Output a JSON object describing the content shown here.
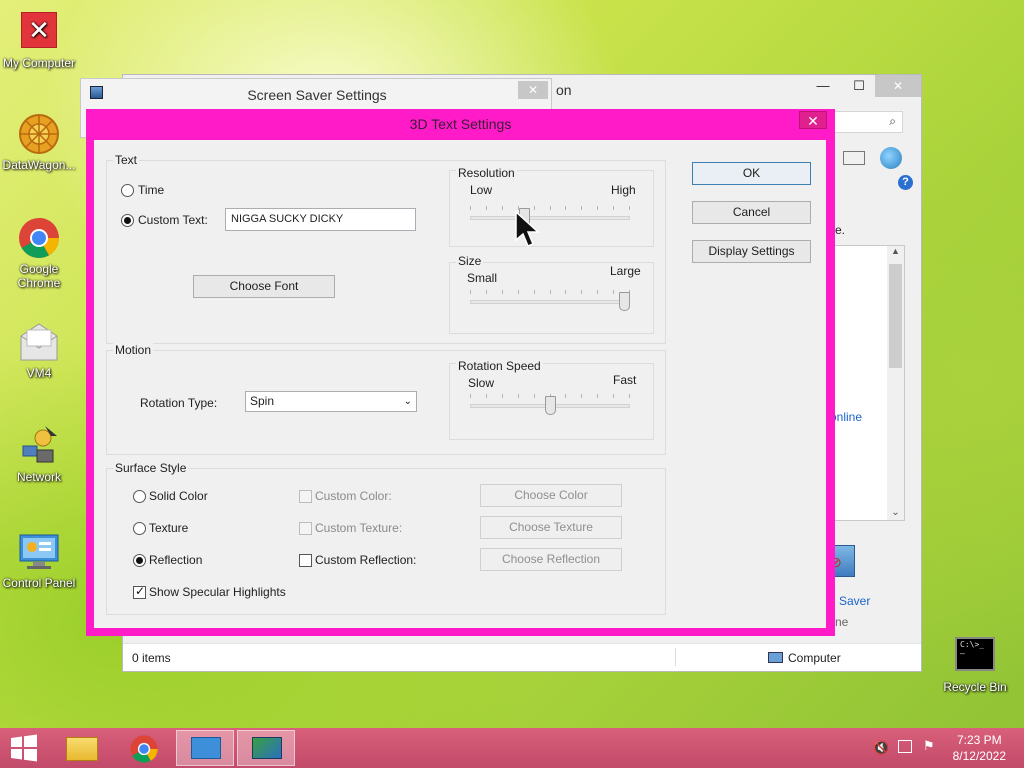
{
  "desktop": {
    "icons": [
      {
        "label": "My Computer"
      },
      {
        "label": "DataWagon..."
      },
      {
        "label": "Google Chrome"
      },
      {
        "label": "VM4"
      },
      {
        "label": "Network"
      },
      {
        "label": "Control Panel"
      },
      {
        "label": "Recycle Bin"
      }
    ]
  },
  "explorer": {
    "title_fragment": "on",
    "side_text_1": "e.",
    "side_link": "online",
    "screen_saver_label": "Saver",
    "side_text_2": "ne",
    "status_items": "0 items",
    "status_location": "Computer"
  },
  "screen_saver_window": {
    "title": "Screen Saver Settings",
    "close": "✕"
  },
  "dialog": {
    "title": "3D Text Settings",
    "close": "✕",
    "text_group": {
      "label": "Text",
      "time_label": "Time",
      "custom_text_label": "Custom Text:",
      "custom_text_value": "NIGGA SUCKY DICKY",
      "choose_font": "Choose Font",
      "selected": "custom_text"
    },
    "resolution": {
      "label": "Resolution",
      "min_label": "Low",
      "max_label": "High",
      "value_fraction": 0.33
    },
    "size": {
      "label": "Size",
      "min_label": "Small",
      "max_label": "Large",
      "value_fraction": 1.0
    },
    "motion_group": {
      "label": "Motion",
      "rotation_type_label": "Rotation Type:",
      "rotation_type_value": "Spin"
    },
    "rotation_speed": {
      "label": "Rotation Speed",
      "min_label": "Slow",
      "max_label": "Fast",
      "value_fraction": 0.5
    },
    "surface_group": {
      "label": "Surface Style",
      "solid_color": "Solid Color",
      "texture": "Texture",
      "reflection": "Reflection",
      "selected": "reflection",
      "custom_color": "Custom Color:",
      "custom_texture": "Custom Texture:",
      "custom_reflection": "Custom Reflection:",
      "choose_color": "Choose Color",
      "choose_texture": "Choose Texture",
      "choose_reflection": "Choose Reflection",
      "specular": "Show Specular Highlights",
      "specular_checked": true
    },
    "buttons": {
      "ok": "OK",
      "cancel": "Cancel",
      "display_settings": "Display Settings"
    }
  },
  "taskbar": {
    "time": "7:23 PM",
    "date": "8/12/2022"
  },
  "colors": {
    "dialog_frame": "#ff1cc8",
    "taskbar": "#c94d6d",
    "link": "#1a64c8"
  }
}
